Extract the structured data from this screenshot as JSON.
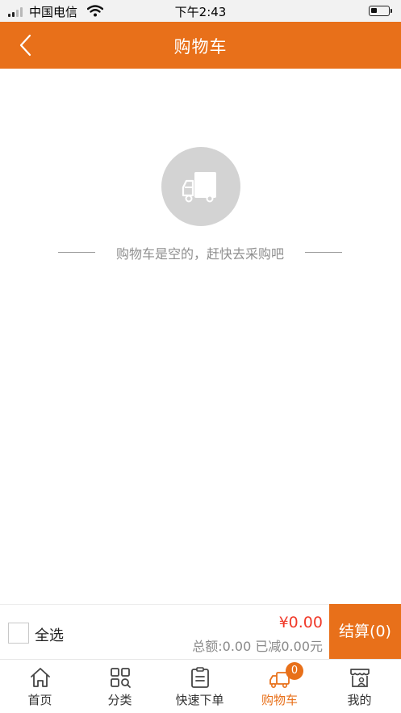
{
  "status_bar": {
    "carrier": "中国电信",
    "time": "下午2:43"
  },
  "nav": {
    "title": "购物车",
    "back_icon": "chevron-left-icon"
  },
  "empty_state": {
    "icon": "delivery-truck-icon",
    "message": "购物车是空的，赶快去采购吧"
  },
  "checkout": {
    "select_all_label": "全选",
    "total_price": "¥0.00",
    "total_detail": "总额:0.00 已减0.00元",
    "checkout_button_label": "结算(0)"
  },
  "tabs": [
    {
      "label": "首页",
      "icon": "home-icon",
      "active": false
    },
    {
      "label": "分类",
      "icon": "category-grid-icon",
      "active": false
    },
    {
      "label": "快速下单",
      "icon": "clipboard-icon",
      "active": false
    },
    {
      "label": "购物车",
      "icon": "truck-cart-icon",
      "active": true,
      "badge": "0"
    },
    {
      "label": "我的",
      "icon": "profile-store-icon",
      "active": false
    }
  ],
  "colors": {
    "accent": "#e8701a",
    "price": "#f03a2a",
    "empty_icon_bg": "#d3d3d3"
  }
}
